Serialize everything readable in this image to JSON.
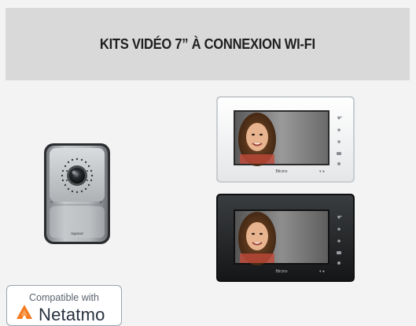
{
  "header": {
    "title": "KITS VIDÉO 7” À CONNEXION WI-FI"
  },
  "badge": {
    "line1": "Compatible with",
    "brand": "Netatmo",
    "logo_icon": "netatmo-logo-icon",
    "logo_color": "#f47b20"
  },
  "doorbell": {
    "brand_text": "legrand"
  },
  "monitors": {
    "white_brand": "Bticino",
    "black_brand": "Bticino"
  },
  "colors": {
    "header_band": "#d9d9d9",
    "page_bg": "#f3f3f3",
    "title_color": "#1f1f1f"
  }
}
